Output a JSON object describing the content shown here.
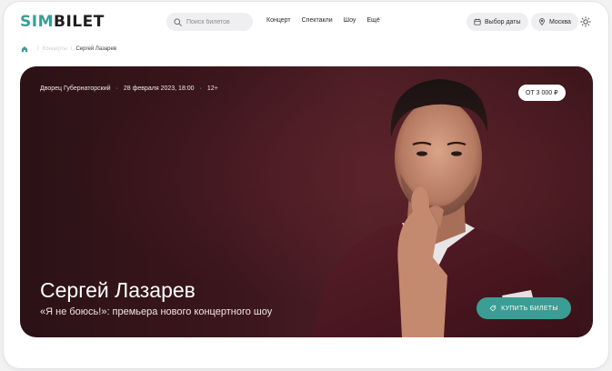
{
  "header": {
    "logo_part1": "SIM",
    "logo_part2": "BILET",
    "search": {
      "placeholder": "Поиск билетов"
    },
    "nav": [
      "Концерт",
      "Спектакли",
      "Шоу",
      "Ещё"
    ],
    "date_button": "Выбор даты",
    "city_button": "Москва",
    "icons": {
      "search": "search-icon",
      "calendar": "calendar-icon",
      "location": "location-pin-icon",
      "theme": "sun-icon"
    }
  },
  "breadcrumb": {
    "section": "Концерты",
    "current": "Сергей Лазарев"
  },
  "hero": {
    "venue": "Дворец Губернаторский",
    "date": "28 февраля 2023, 18:00",
    "age": "12+",
    "price": "ОТ 3 000 ₽",
    "title": "Сергей Лазарев",
    "subtitle": "«Я не боюсь!»: премьера нового концертного шоу",
    "buy_label": "КУПИТЬ БИЛЕТЫ"
  },
  "colors": {
    "accent": "#3a9e94",
    "hero_bg": "#3a151c",
    "text_dark": "#1c1c1c"
  }
}
